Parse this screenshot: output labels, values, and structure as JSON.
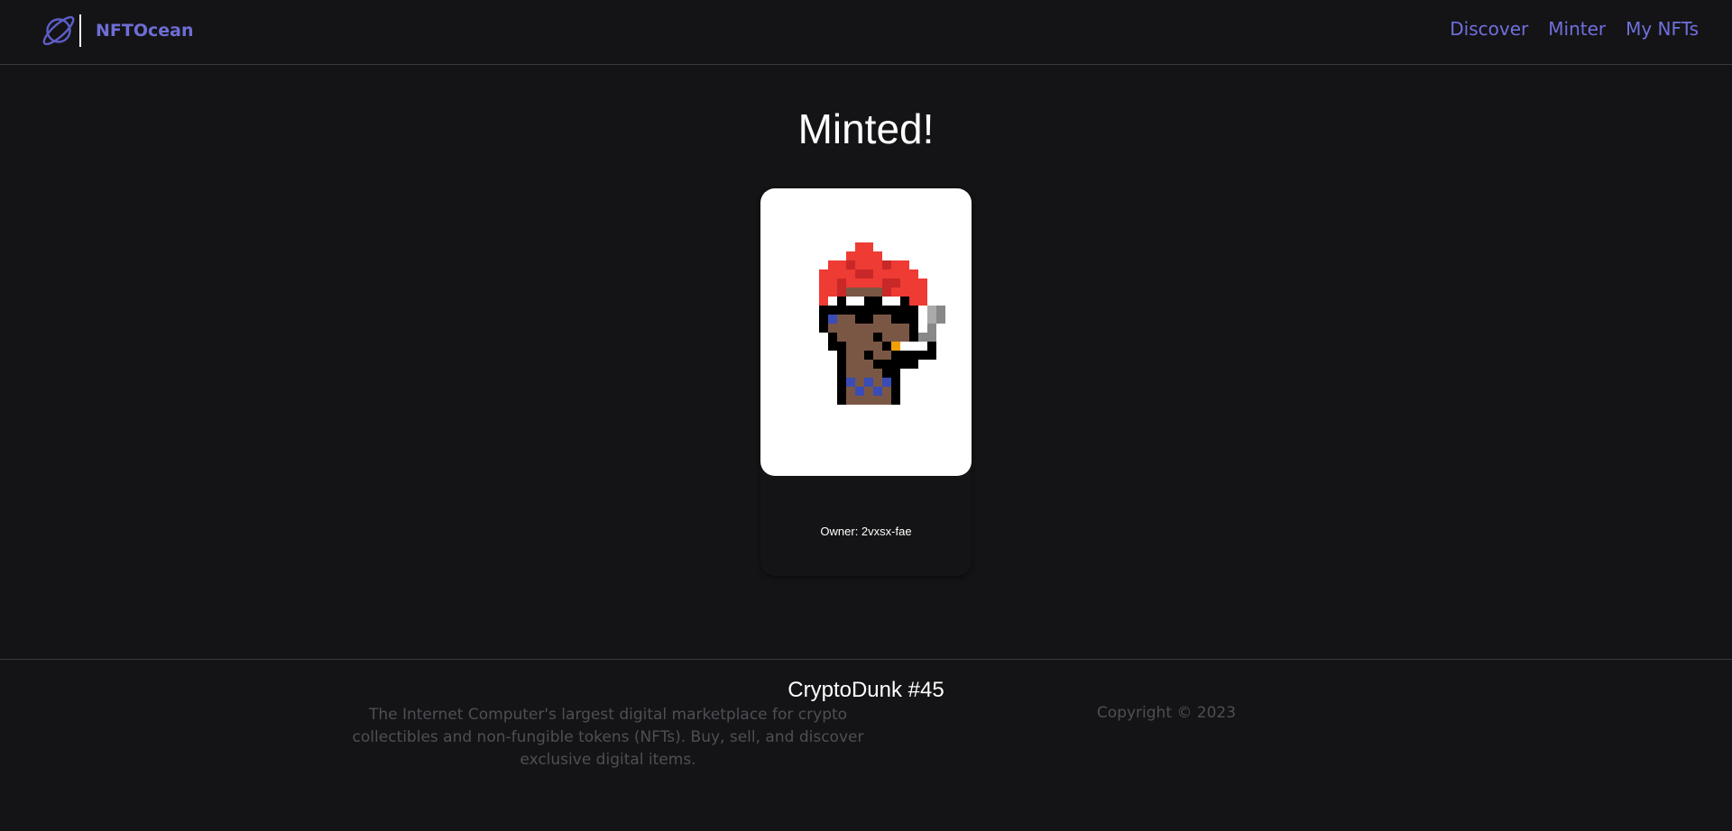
{
  "header": {
    "brand_name": "NFTOcean",
    "logo_icon": "planet-icon",
    "nav": [
      {
        "label": "Discover"
      },
      {
        "label": "Minter"
      },
      {
        "label": "My NFTs"
      }
    ],
    "accent_color": "#6f70dd"
  },
  "main": {
    "title": "Minted!",
    "nft": {
      "name": "CryptoDunk #45",
      "owner": "Owner: 2vxsx-fae",
      "image_icon": "pixel-art-avatar"
    }
  },
  "footer": {
    "description": "The Internet Computer's largest digital marketplace for crypto collectibles and non-fungible tokens (NFTs). Buy, sell, and discover exclusive digital items.",
    "copyright": "Copyright © 2023"
  },
  "colors": {
    "background": "#141416",
    "divider": "#3a3a3e",
    "muted_text": "#4e4e55"
  }
}
